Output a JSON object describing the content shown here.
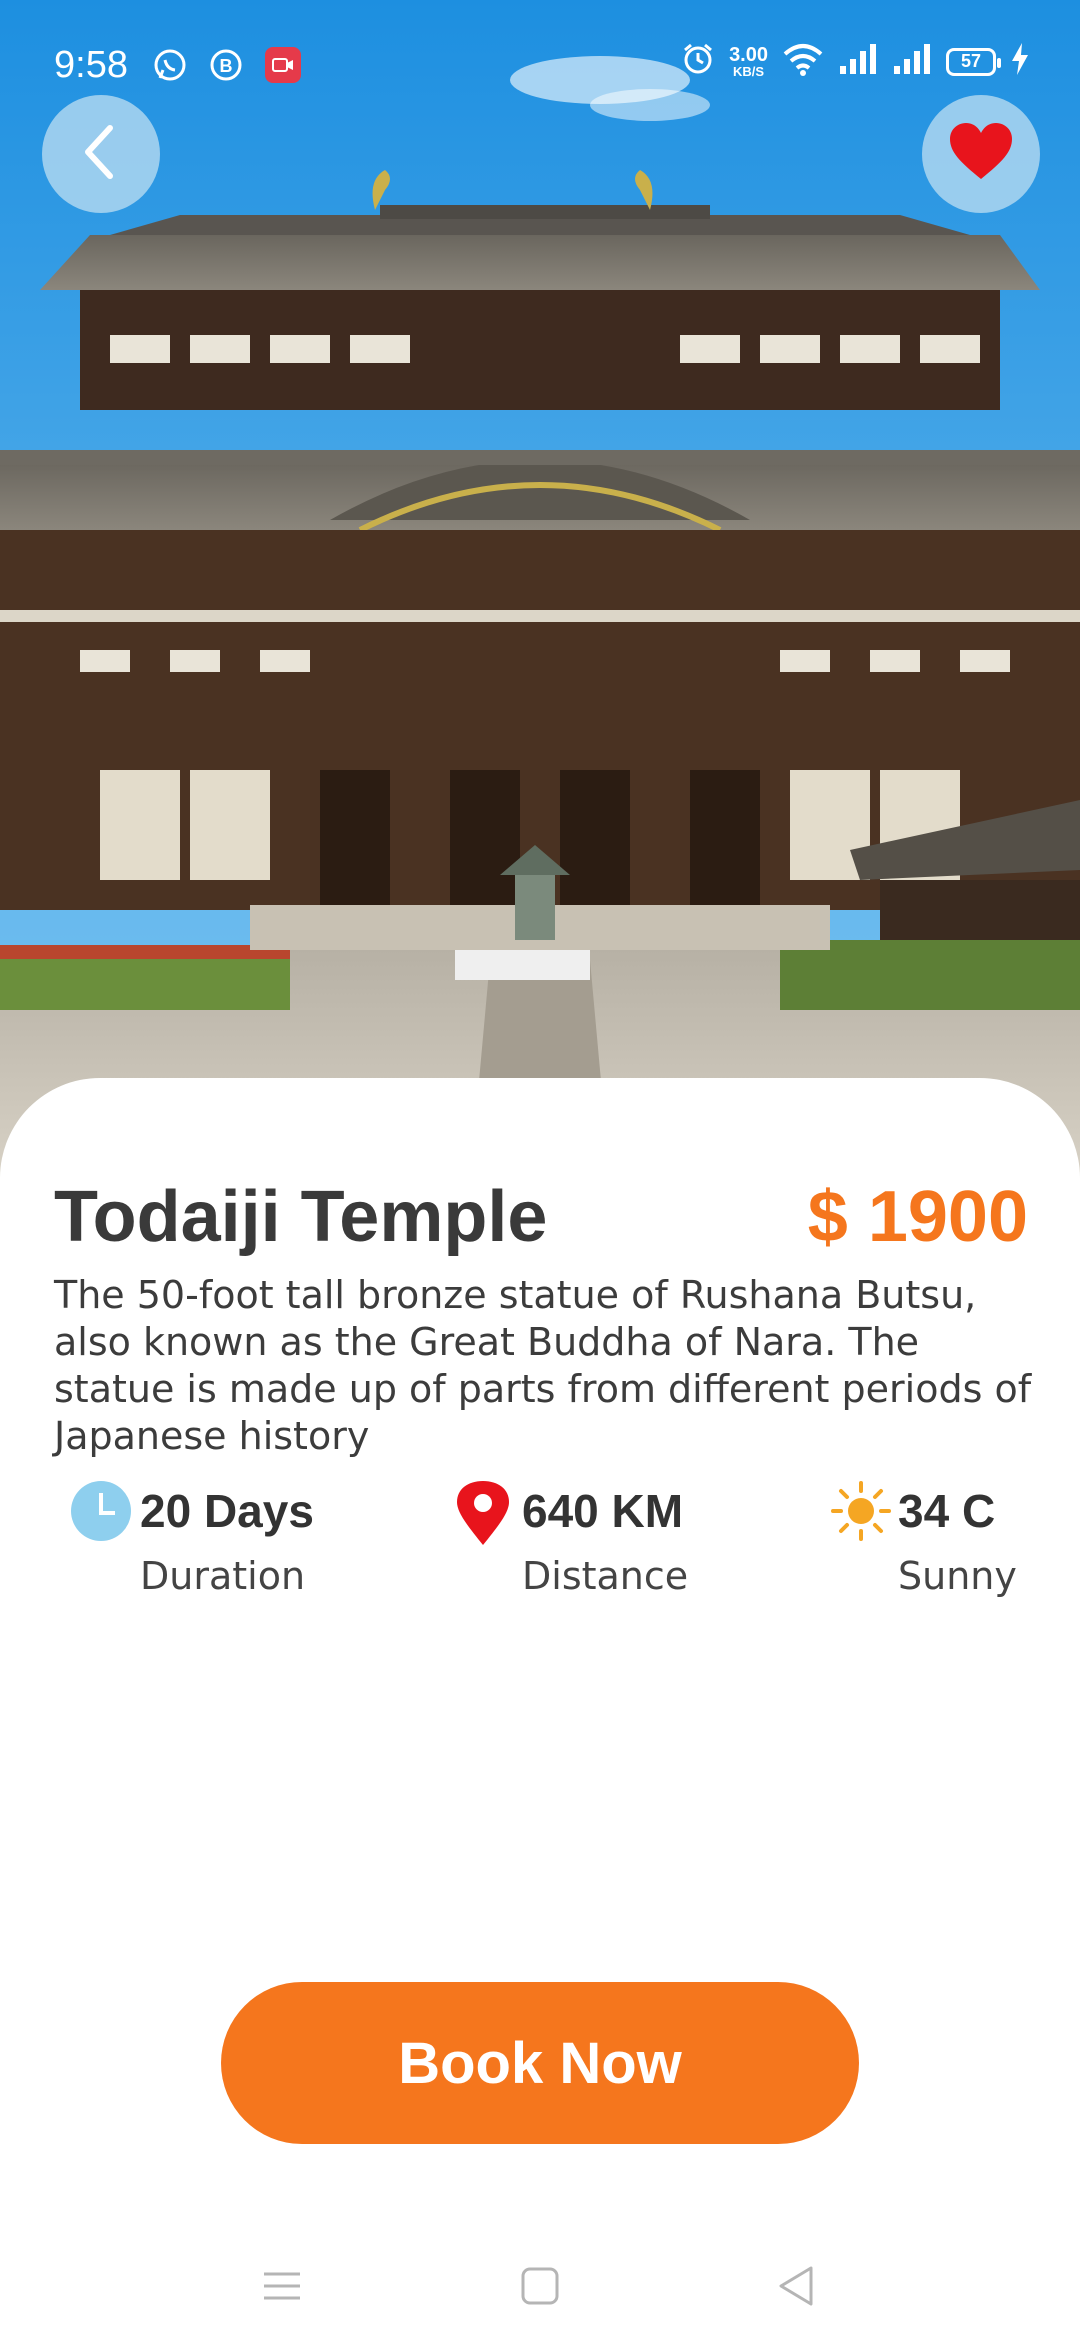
{
  "status_bar": {
    "time": "9:58",
    "net_speed_value": "3.00",
    "net_speed_unit": "KB/S",
    "battery": "57",
    "icons": [
      "whatsapp-icon",
      "b-notification-icon",
      "screen-record-icon",
      "alarm-icon",
      "wifi-icon",
      "signal-icon",
      "signal-icon",
      "battery-icon",
      "charging-icon"
    ]
  },
  "header": {
    "back_icon": "chevron-left-icon",
    "favorite_icon": "heart-icon",
    "favorite_color": "#e8141c"
  },
  "place": {
    "name": "Todaiji Temple",
    "price": "$ 1900",
    "description": "The 50-foot tall bronze statue of Rushana Butsu, also known as the Great Buddha of Nara. The statue is made up of parts from different periods of Japanese history"
  },
  "stats": {
    "duration": {
      "value": "20 Days",
      "label": "Duration",
      "icon": "clock-icon"
    },
    "distance": {
      "value": "640 KM",
      "label": "Distance",
      "icon": "location-pin-icon"
    },
    "weather": {
      "value": "34 C",
      "label": "Sunny",
      "icon": "sun-icon"
    }
  },
  "cta": {
    "label": "Book Now"
  },
  "colors": {
    "accent": "#f5761d",
    "text_dark": "#3a3a3a",
    "clock": "#8ecfee",
    "pin": "#e8141c",
    "sun": "#f5a623"
  },
  "navbar": [
    "menu-icon",
    "home-square-icon",
    "back-triangle-icon"
  ]
}
